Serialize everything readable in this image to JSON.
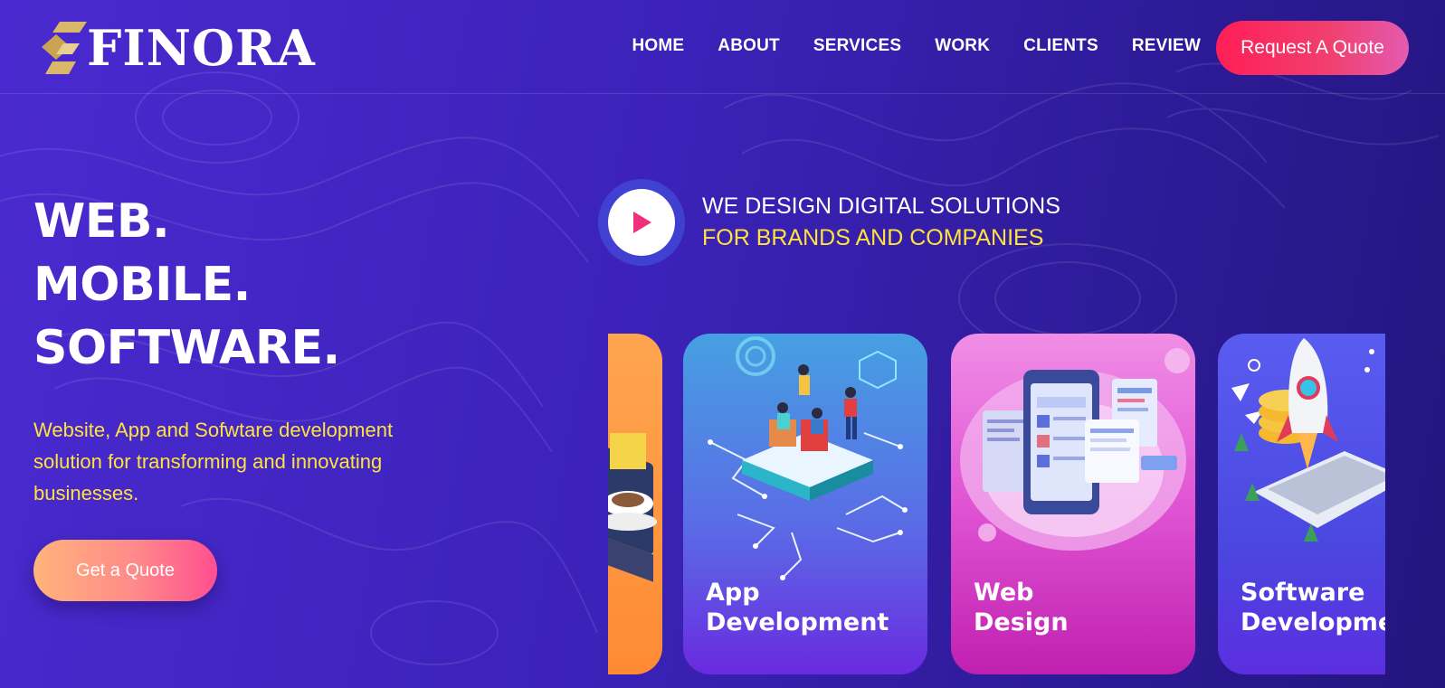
{
  "brand": {
    "name": "FINORA",
    "accent": "#d9b86a"
  },
  "nav": {
    "items": [
      "HOME",
      "ABOUT",
      "SERVICES",
      "WORK",
      "CLIENTS",
      "REVIEW"
    ],
    "cta_label": "Request A Quote"
  },
  "hero": {
    "lines": [
      "WEB.",
      "MOBILE.",
      "SOFTWARE."
    ],
    "description": "Website, App and Sofwtare development solution for transforming and innovating businesses.",
    "button_label": "Get a Quote"
  },
  "tagline": {
    "line1": "WE DESIGN DIGITAL SOLUTIONS",
    "line2": "FOR BRANDS AND COMPANIES",
    "play_icon": "play-icon"
  },
  "cards": [
    {
      "label_line1": "",
      "label_line2": "",
      "theme": "#ff9a3c"
    },
    {
      "label_line1": "App",
      "label_line2": "Development",
      "theme": "#3d8ee0"
    },
    {
      "label_line1": "Web",
      "label_line2": "Design",
      "theme": "#e24fd4"
    },
    {
      "label_line1": "Software",
      "label_line2": "Development",
      "theme": "#4a4fe0"
    }
  ],
  "colors": {
    "yellow": "#ffe33d",
    "pink": "#ff1e56"
  }
}
